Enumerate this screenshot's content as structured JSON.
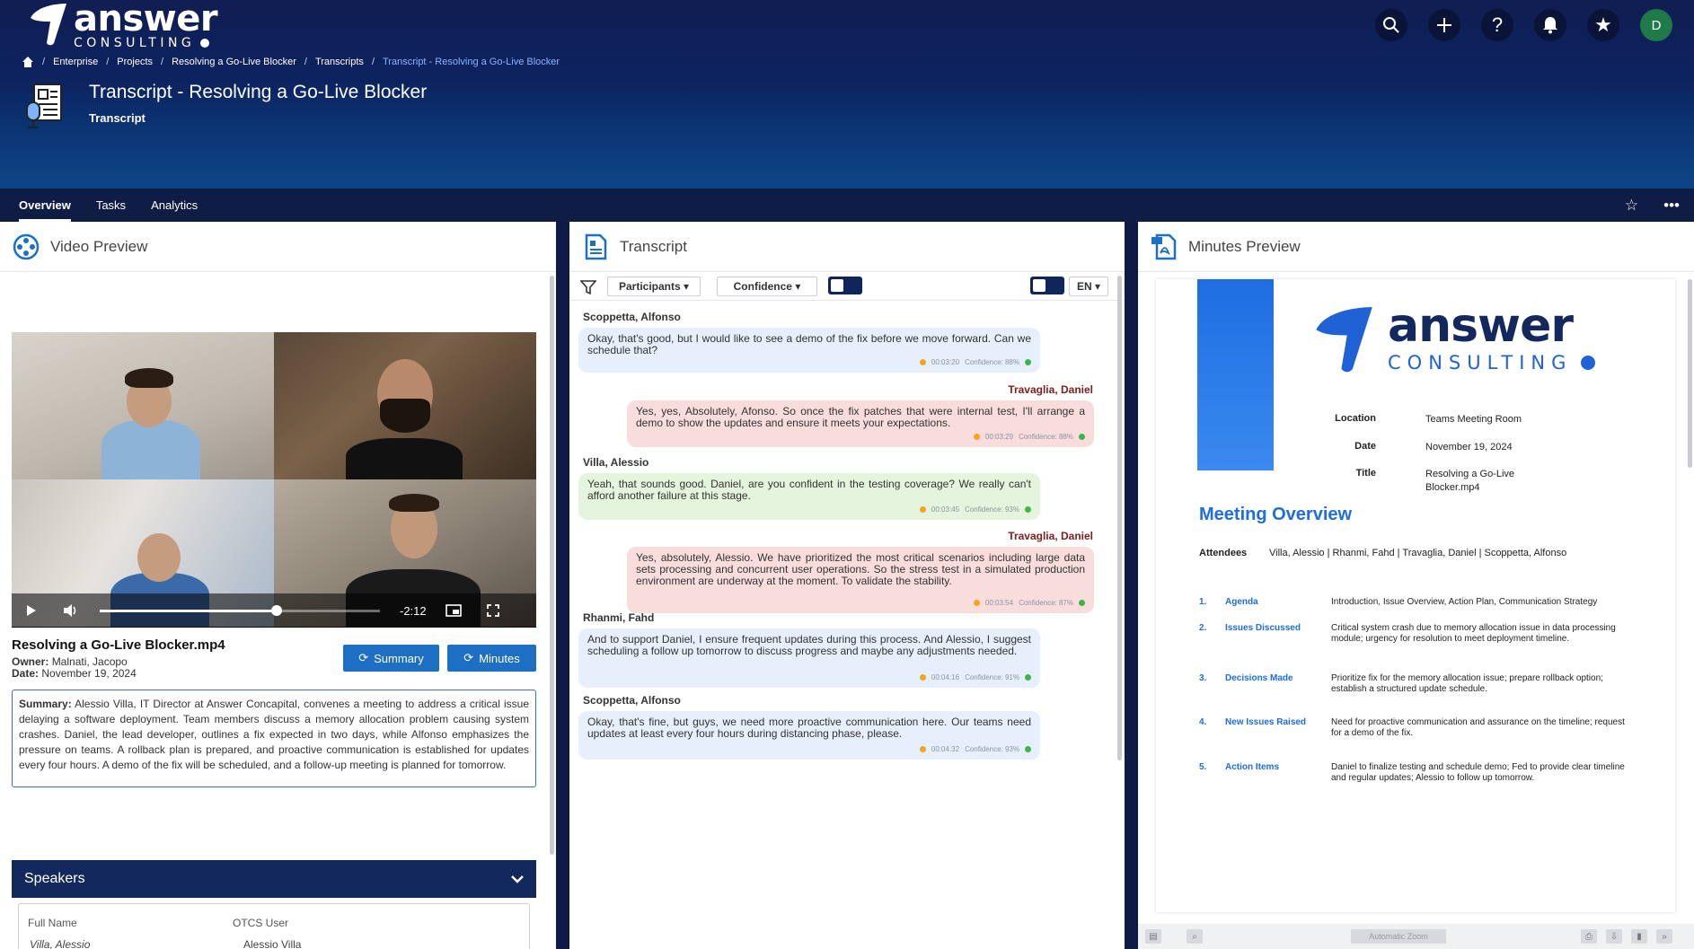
{
  "brand": {
    "name": "answer",
    "sub": "CONSULTING"
  },
  "top_icons": [
    {
      "name": "search-icon",
      "glyph": "⌕"
    },
    {
      "name": "plus-icon",
      "glyph": "+"
    },
    {
      "name": "help-icon",
      "glyph": "?"
    },
    {
      "name": "bell-icon",
      "glyph": "🔔"
    },
    {
      "name": "star-icon",
      "glyph": "★"
    }
  ],
  "user": {
    "initial": "D",
    "color": "#1f7a4a"
  },
  "breadcrumb": [
    "Enterprise",
    "Projects",
    "Resolving a Go-Live Blocker",
    "Transcripts",
    "Transcript - Resolving a Go-Live Blocker"
  ],
  "page": {
    "title": "Transcript - Resolving a Go-Live Blocker",
    "subtitle": "Transcript"
  },
  "tabs": [
    "Overview",
    "Tasks",
    "Analytics"
  ],
  "tabs_right": {
    "star": "☆",
    "more": "•••"
  },
  "video_panel": {
    "title": "Video Preview",
    "time_remaining": "-2:12",
    "progress": 0.63,
    "file_name": "Resolving a Go-Live Blocker.mp4",
    "owner_label": "Owner:",
    "owner": "Malnati, Jacopo",
    "date_label": "Date:",
    "date": "November 19, 2024",
    "summary_button": "Summary",
    "minutes_button": "Minutes",
    "summary_label": "Summary:",
    "summary_text": "Alessio Villa, IT Director at Answer Concapital, convenes a meeting to address a critical issue delaying a software deployment. Team members discuss a memory allocation problem causing system crashes. Daniel, the lead developer, outlines a fix expected in two days, while Alfonso emphasizes the pressure on teams. A rollback plan is prepared, and proactive communication is established for updates every four hours. A demo of the fix will be scheduled, and a follow-up meeting is planned for tomorrow.",
    "speakers_title": "Speakers",
    "speakers_cols": [
      "Full Name",
      "OTCS User"
    ],
    "speakers_row": [
      "Villa, Alessio",
      "Alessio Villa"
    ]
  },
  "transcript_panel": {
    "title": "Transcript",
    "filter_participants": "Participants ▾",
    "filter_confidence": "Confidence ▾",
    "language": "EN",
    "messages": [
      {
        "speaker": "Scoppetta, Alfonso",
        "text": "Okay, that's good, but I would like to see a demo of the fix before we move forward. Can we schedule that?",
        "time": "00:03:20",
        "confidence": "Confidence: 88%",
        "side": "left",
        "color": "blue"
      },
      {
        "speaker": "Travaglia, Daniel",
        "text": "Yes, yes, Absolutely, Afonso. So once the fix patches that were internal test, I'll arrange a demo to show the updates and ensure it meets your expectations.",
        "time": "00:03:29",
        "confidence": "Confidence: 88%",
        "side": "right",
        "color": "pink"
      },
      {
        "speaker": "Villa, Alessio",
        "text": "Yeah, that sounds good. Daniel, are you confident in the testing coverage? We really can't afford another failure at this stage.",
        "time": "00:03:45",
        "confidence": "Confidence: 93%",
        "side": "left",
        "color": "green"
      },
      {
        "speaker": "Travaglia, Daniel",
        "text": "Yes, absolutely, Alessio. We have prioritized the most critical scenarios including large data sets processing and concurrent user operations. So the stress test in a simulated production environment are underway at the moment. To validate the stability.",
        "time": "00:03:54",
        "confidence": "Confidence: 87%",
        "side": "right",
        "color": "pink"
      },
      {
        "speaker": "Rhanmi, Fahd",
        "text": "And to support Daniel, I ensure frequent updates during this process. And Alessio, I suggest scheduling a follow up tomorrow to discuss progress and maybe any adjustments needed.",
        "time": "00:04:16",
        "confidence": "Confidence: 91%",
        "side": "left",
        "color": "blue"
      },
      {
        "speaker": "Scoppetta, Alfonso",
        "text": "Okay, that's fine, but guys, we need more proactive communication here. Our teams need updates at least every four hours during distancing phase, please.",
        "time": "00:04:32",
        "confidence": "Confidence: 93%",
        "side": "left",
        "color": "blue"
      }
    ]
  },
  "minutes_panel": {
    "title": "Minutes Preview",
    "logo_answer": "answer",
    "logo_consulting": "CONSULTING",
    "location_label": "Location",
    "location": "Teams Meeting Room",
    "date_label": "Date",
    "date": "November 19, 2024",
    "title_label": "Title",
    "title_value": "Resolving a Go-Live Blocker.mp4",
    "overview_heading": "Meeting Overview",
    "attendees_label": "Attendees",
    "attendees": "Villa, Alessio | Rhanmi, Fahd | Travaglia, Daniel | Scoppetta, Alfonso",
    "items": [
      {
        "num": "1.",
        "label": "Agenda",
        "desc": "Introduction, Issue Overview, Action Plan, Communication Strategy"
      },
      {
        "num": "2.",
        "label": "Issues Discussed",
        "desc": "Critical system crash due to memory allocation issue in data processing module; urgency for resolution to meet deployment timeline."
      },
      {
        "num": "3.",
        "label": "Decisions Made",
        "desc": "Prioritize fix for the memory allocation issue; prepare rollback option; establish a structured update schedule."
      },
      {
        "num": "4.",
        "label": "New Issues Raised",
        "desc": "Need for proactive communication and assurance on the timeline; request for a demo of the fix."
      },
      {
        "num": "5.",
        "label": "Action Items",
        "desc": "Daniel to finalize testing and schedule demo; Fed to provide clear timeline and regular updates; Alessio to follow up tomorrow."
      }
    ],
    "zoom_label": "Automatic Zoom"
  },
  "colors": {
    "header_dark": "#101e52",
    "accent_blue": "#1d6fc4",
    "speakers_bar": "#13285c"
  }
}
